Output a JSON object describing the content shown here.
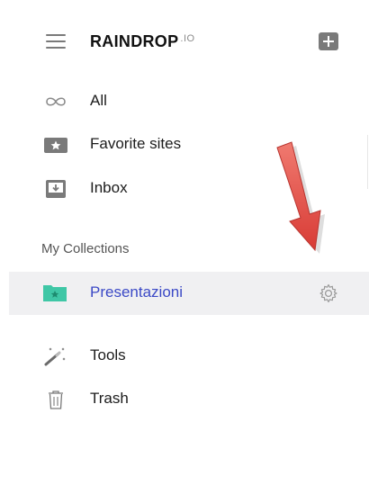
{
  "header": {
    "brand": "RAINDROP",
    "brand_suffix": ".IO"
  },
  "nav": {
    "all": {
      "label": "All",
      "icon": "infinity-icon"
    },
    "favorites": {
      "label": "Favorite sites",
      "icon": "star-icon"
    },
    "inbox": {
      "label": "Inbox",
      "icon": "inbox-icon"
    }
  },
  "collections": {
    "title": "My Collections",
    "items": [
      {
        "label": "Presentazioni",
        "icon": "folder-star-icon",
        "selected": true
      }
    ]
  },
  "footer_nav": {
    "tools": {
      "label": "Tools",
      "icon": "magic-wand-icon"
    },
    "trash": {
      "label": "Trash",
      "icon": "trash-icon"
    }
  },
  "colors": {
    "accent": "#3b49c6",
    "folder": "#3fc7a6",
    "selected_bg": "#f0f0f2",
    "arrow": "#e0453f"
  }
}
